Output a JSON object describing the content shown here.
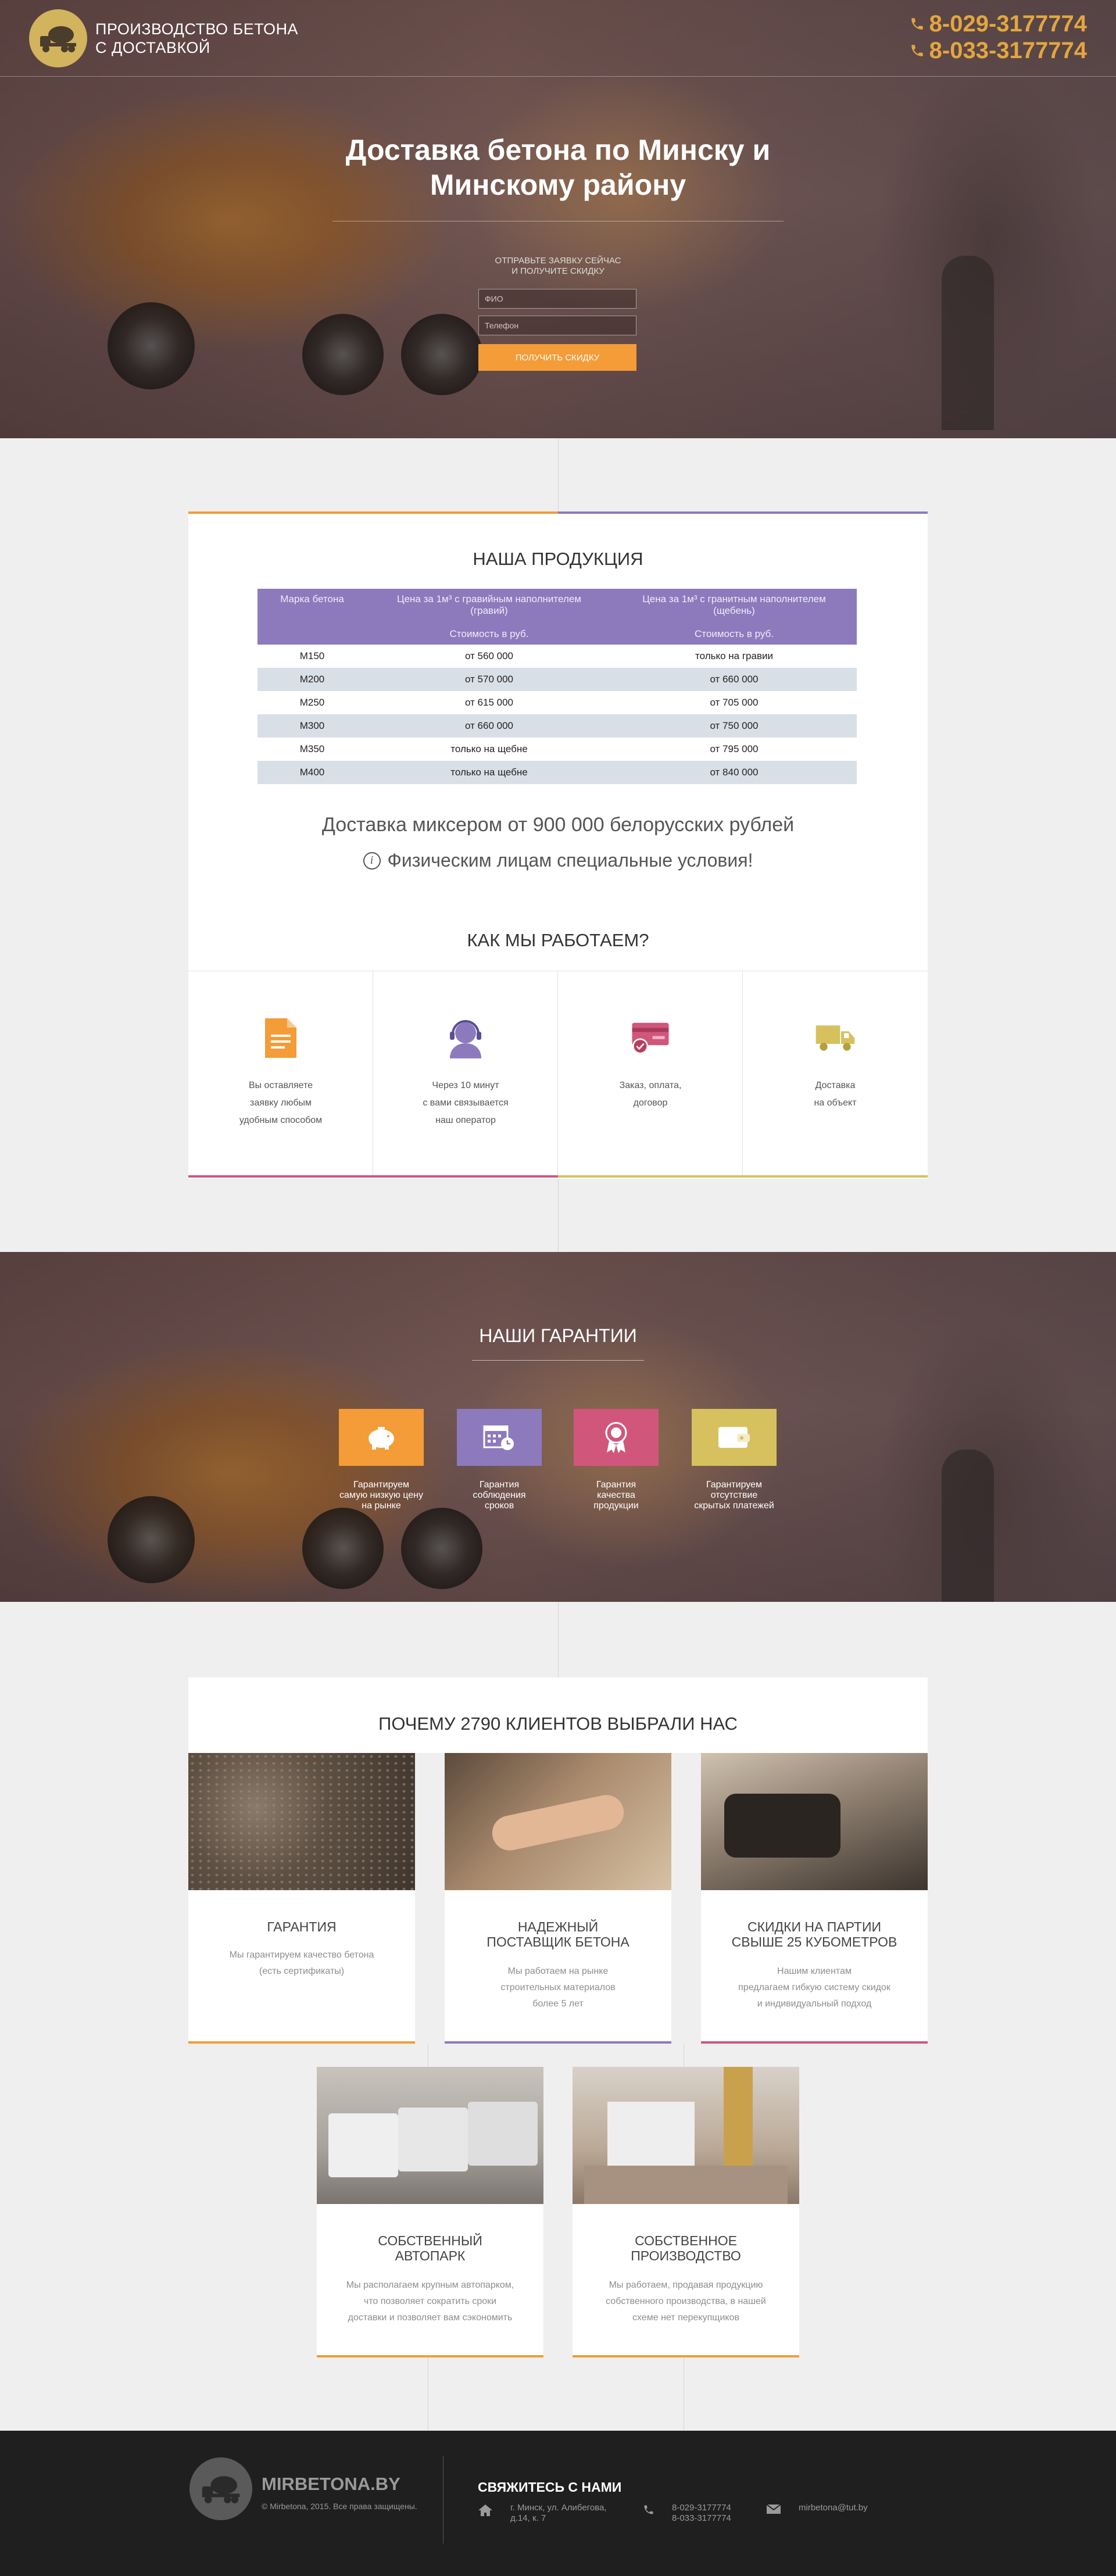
{
  "header": {
    "title_line1": "ПРОИЗВОДСТВО БЕТОНА",
    "title_line2": "С ДОСТАВКОЙ",
    "phone1": "8-029-3177774",
    "phone2": "8-033-3177774"
  },
  "hero": {
    "title_line1": "Доставка бетона по Минску и",
    "title_line2": "Минскому району",
    "subtitle_line1": "ОТПРАВЬТЕ ЗАЯВКУ СЕЙЧАС",
    "subtitle_line2": "И ПОЛУЧИТЕ СКИДКУ",
    "name_placeholder": "ФИО",
    "phone_placeholder": "Телефон",
    "button": "ПОЛУЧИТЬ СКИДКУ"
  },
  "products": {
    "title": "НАША ПРОДУКЦИЯ",
    "col1": "Марка бетона",
    "col2_line1": "Цена за 1м³ с гравийным наполнителем",
    "col2_line2": "(гравий)",
    "col3_line1": "Цена за 1м³ с гранитным наполнителем",
    "col3_line2": "(щебень)",
    "sub2": "Стоимость в руб.",
    "sub3": "Стоимость в руб.",
    "rows": [
      {
        "mark": "М150",
        "gravel": "от 560 000",
        "granite": "только на гравии"
      },
      {
        "mark": "М200",
        "gravel": "от 570 000",
        "granite": "от 660 000"
      },
      {
        "mark": "М250",
        "gravel": "от 615 000",
        "granite": "от 705 000"
      },
      {
        "mark": "М300",
        "gravel": "от 660 000",
        "granite": "от 750 000"
      },
      {
        "mark": "М350",
        "gravel": "только на щебне",
        "granite": "от 795 000"
      },
      {
        "mark": "М400",
        "gravel": "только на щебне",
        "granite": "от 840 000"
      }
    ],
    "delivery": "Доставка миксером от 900 000 белорусских рублей",
    "individuals": "Физическим лицам специальные условия!"
  },
  "how": {
    "title": "КАК МЫ РАБОТАЕМ?",
    "steps": [
      {
        "text": "Вы оставляете\nзаявку любым\nудобным способом",
        "color": "#f39c38",
        "icon": "document-icon"
      },
      {
        "text": "Через 10 минут\nс вами связывается\nнаш оператор",
        "color": "#8c7abd",
        "icon": "operator-icon"
      },
      {
        "text": "Заказ, оплата,\nдоговор",
        "color": "#d1567c",
        "icon": "card-payment-icon"
      },
      {
        "text": "Доставка\nна объект",
        "color": "#d6c15e",
        "icon": "truck-icon"
      }
    ]
  },
  "guarantees": {
    "title": "НАШИ ГАРАНТИИ",
    "items": [
      {
        "text": "Гарантируем\nсамую низкую цену\nна рынке",
        "color": "#f39c38",
        "icon": "piggy-bank-icon"
      },
      {
        "text": "Гарантия\nсоблюдения\nсроков",
        "color": "#8c7abd",
        "icon": "calendar-clock-icon"
      },
      {
        "text": "Гарантия\nкачества\nпродукции",
        "color": "#d1567c",
        "icon": "award-icon"
      },
      {
        "text": "Гарантируем\nотсутствие\nскрытых платежей",
        "color": "#d6c15e",
        "icon": "wallet-icon"
      }
    ]
  },
  "why": {
    "title": "ПОЧЕМУ 2790 КЛИЕНТОВ ВЫБРАЛИ НАС",
    "items": [
      {
        "title": "ГАРАНТИЯ",
        "desc": "Мы гарантируем качество бетона\n(есть сертификаты)",
        "color": "#f39c38"
      },
      {
        "title": "НАДЕЖНЫЙ\nПОСТАВЩИК БЕТОНА",
        "desc": "Мы работаем на рынке\nстроительных материалов\nболее 5 лет",
        "color": "#8c7abd"
      },
      {
        "title": "СКИДКИ НА ПАРТИИ\nСВЫШЕ 25 КУБОМЕТРОВ",
        "desc": "Нашим клиентам\nпредлагаем гибкую систему скидок\nи индивидуальный подход",
        "color": "#d1567c"
      },
      {
        "title": "СОБСТВЕННЫЙ\nАВТОПАРК",
        "desc": "Мы располагаем крупным автопарком,\nчто позволяет сократить сроки\nдоставки и позволяет вам сэкономить",
        "color": "#f39c38"
      },
      {
        "title": "СОБСТВЕННОЕ\nПРОИЗВОДСТВО",
        "desc": "Мы работаем, продавая продукцию\nсобственного производства, в нашей\nсхеме нет перекупщиков",
        "color": "#f39c38"
      }
    ]
  },
  "footer": {
    "brand": "MIRBETONA.BY",
    "copyright": "© Mirbetona, 2015. Все права защищены.",
    "contact_title": "СВЯЖИТЕСЬ С НАМИ",
    "address": "г. Минск, ул. Алибегова,\nд.14, к. 7",
    "phones": "8-029-3177774\n8-033-3177774",
    "email": "mirbetona@tut.by"
  }
}
